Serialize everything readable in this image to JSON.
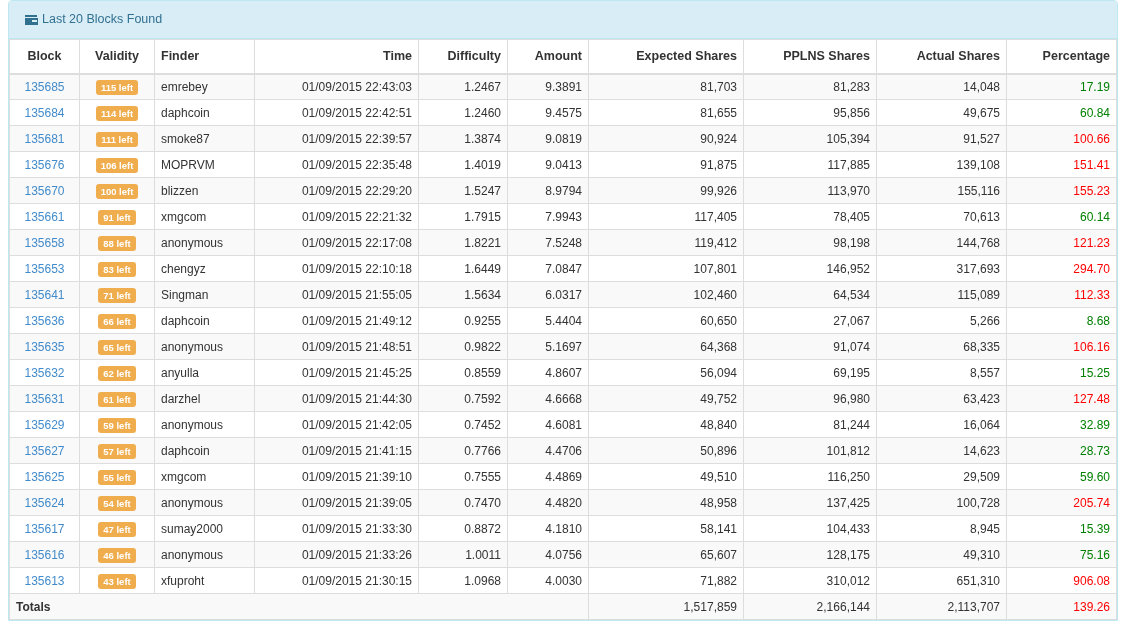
{
  "panel": {
    "title": "Last 20 Blocks Found"
  },
  "table": {
    "columns": [
      "Block",
      "Validity",
      "Finder",
      "Time",
      "Difficulty",
      "Amount",
      "Expected Shares",
      "PPLNS Shares",
      "Actual Shares",
      "Percentage"
    ],
    "rows": [
      {
        "block": "135685",
        "validity": "115 left",
        "finder": "emrebey",
        "time": "01/09/2015 22:43:03",
        "difficulty": "1.2467",
        "amount": "9.3891",
        "expected": "81,703",
        "pplns": "81,283",
        "actual": "14,048",
        "percentage": "17.19",
        "color": "#008000"
      },
      {
        "block": "135684",
        "validity": "114 left",
        "finder": "daphcoin",
        "time": "01/09/2015 22:42:51",
        "difficulty": "1.2460",
        "amount": "9.4575",
        "expected": "81,655",
        "pplns": "95,856",
        "actual": "49,675",
        "percentage": "60.84",
        "color": "#008000"
      },
      {
        "block": "135681",
        "validity": "111 left",
        "finder": "smoke87",
        "time": "01/09/2015 22:39:57",
        "difficulty": "1.3874",
        "amount": "9.0819",
        "expected": "90,924",
        "pplns": "105,394",
        "actual": "91,527",
        "percentage": "100.66",
        "color": "#ff0000"
      },
      {
        "block": "135676",
        "validity": "106 left",
        "finder": "MOPRVM",
        "time": "01/09/2015 22:35:48",
        "difficulty": "1.4019",
        "amount": "9.0413",
        "expected": "91,875",
        "pplns": "117,885",
        "actual": "139,108",
        "percentage": "151.41",
        "color": "#ff0000"
      },
      {
        "block": "135670",
        "validity": "100 left",
        "finder": "blizzen",
        "time": "01/09/2015 22:29:20",
        "difficulty": "1.5247",
        "amount": "8.9794",
        "expected": "99,926",
        "pplns": "113,970",
        "actual": "155,116",
        "percentage": "155.23",
        "color": "#ff0000"
      },
      {
        "block": "135661",
        "validity": "91 left",
        "finder": "xmgcom",
        "time": "01/09/2015 22:21:32",
        "difficulty": "1.7915",
        "amount": "7.9943",
        "expected": "117,405",
        "pplns": "78,405",
        "actual": "70,613",
        "percentage": "60.14",
        "color": "#008000"
      },
      {
        "block": "135658",
        "validity": "88 left",
        "finder": "anonymous",
        "time": "01/09/2015 22:17:08",
        "difficulty": "1.8221",
        "amount": "7.5248",
        "expected": "119,412",
        "pplns": "98,198",
        "actual": "144,768",
        "percentage": "121.23",
        "color": "#ff0000"
      },
      {
        "block": "135653",
        "validity": "83 left",
        "finder": "chengyz",
        "time": "01/09/2015 22:10:18",
        "difficulty": "1.6449",
        "amount": "7.0847",
        "expected": "107,801",
        "pplns": "146,952",
        "actual": "317,693",
        "percentage": "294.70",
        "color": "#ff0000"
      },
      {
        "block": "135641",
        "validity": "71 left",
        "finder": "Singman",
        "time": "01/09/2015 21:55:05",
        "difficulty": "1.5634",
        "amount": "6.0317",
        "expected": "102,460",
        "pplns": "64,534",
        "actual": "115,089",
        "percentage": "112.33",
        "color": "#ff0000"
      },
      {
        "block": "135636",
        "validity": "66 left",
        "finder": "daphcoin",
        "time": "01/09/2015 21:49:12",
        "difficulty": "0.9255",
        "amount": "5.4404",
        "expected": "60,650",
        "pplns": "27,067",
        "actual": "5,266",
        "percentage": "8.68",
        "color": "#008000"
      },
      {
        "block": "135635",
        "validity": "65 left",
        "finder": "anonymous",
        "time": "01/09/2015 21:48:51",
        "difficulty": "0.9822",
        "amount": "5.1697",
        "expected": "64,368",
        "pplns": "91,074",
        "actual": "68,335",
        "percentage": "106.16",
        "color": "#ff0000"
      },
      {
        "block": "135632",
        "validity": "62 left",
        "finder": "anyulla",
        "time": "01/09/2015 21:45:25",
        "difficulty": "0.8559",
        "amount": "4.8607",
        "expected": "56,094",
        "pplns": "69,195",
        "actual": "8,557",
        "percentage": "15.25",
        "color": "#008000"
      },
      {
        "block": "135631",
        "validity": "61 left",
        "finder": "darzhel",
        "time": "01/09/2015 21:44:30",
        "difficulty": "0.7592",
        "amount": "4.6668",
        "expected": "49,752",
        "pplns": "96,980",
        "actual": "63,423",
        "percentage": "127.48",
        "color": "#ff0000"
      },
      {
        "block": "135629",
        "validity": "59 left",
        "finder": "anonymous",
        "time": "01/09/2015 21:42:05",
        "difficulty": "0.7452",
        "amount": "4.6081",
        "expected": "48,840",
        "pplns": "81,244",
        "actual": "16,064",
        "percentage": "32.89",
        "color": "#008000"
      },
      {
        "block": "135627",
        "validity": "57 left",
        "finder": "daphcoin",
        "time": "01/09/2015 21:41:15",
        "difficulty": "0.7766",
        "amount": "4.4706",
        "expected": "50,896",
        "pplns": "101,812",
        "actual": "14,623",
        "percentage": "28.73",
        "color": "#008000"
      },
      {
        "block": "135625",
        "validity": "55 left",
        "finder": "xmgcom",
        "time": "01/09/2015 21:39:10",
        "difficulty": "0.7555",
        "amount": "4.4869",
        "expected": "49,510",
        "pplns": "116,250",
        "actual": "29,509",
        "percentage": "59.60",
        "color": "#008000"
      },
      {
        "block": "135624",
        "validity": "54 left",
        "finder": "anonymous",
        "time": "01/09/2015 21:39:05",
        "difficulty": "0.7470",
        "amount": "4.4820",
        "expected": "48,958",
        "pplns": "137,425",
        "actual": "100,728",
        "percentage": "205.74",
        "color": "#ff0000"
      },
      {
        "block": "135617",
        "validity": "47 left",
        "finder": "sumay2000",
        "time": "01/09/2015 21:33:30",
        "difficulty": "0.8872",
        "amount": "4.1810",
        "expected": "58,141",
        "pplns": "104,433",
        "actual": "8,945",
        "percentage": "15.39",
        "color": "#008000"
      },
      {
        "block": "135616",
        "validity": "46 left",
        "finder": "anonymous",
        "time": "01/09/2015 21:33:26",
        "difficulty": "1.0011",
        "amount": "4.0756",
        "expected": "65,607",
        "pplns": "128,175",
        "actual": "49,310",
        "percentage": "75.16",
        "color": "#008000"
      },
      {
        "block": "135613",
        "validity": "43 left",
        "finder": "xfuproht",
        "time": "01/09/2015 21:30:15",
        "difficulty": "1.0968",
        "amount": "4.0030",
        "expected": "71,882",
        "pplns": "310,012",
        "actual": "651,310",
        "percentage": "906.08",
        "color": "#ff0000"
      }
    ],
    "totals": {
      "label": "Totals",
      "expected": "1,517,859",
      "pplns": "2,166,144",
      "actual": "2,113,707",
      "percentage": "139.26",
      "color": "#ff0000"
    }
  }
}
